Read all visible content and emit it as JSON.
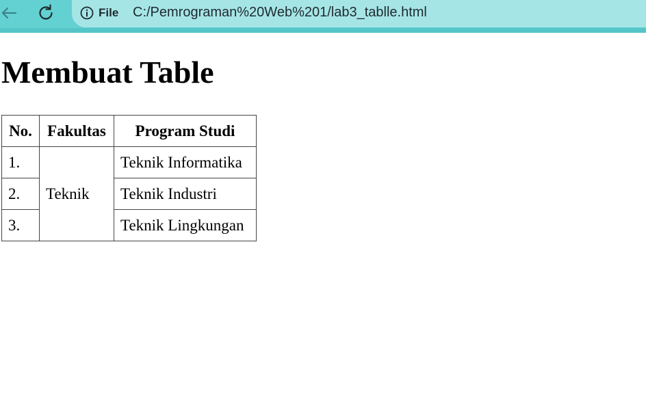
{
  "browser": {
    "site_info_label": "File",
    "url": "C:/Pemrograman%20Web%201/lab3_tablle.html"
  },
  "page": {
    "title": "Membuat Table",
    "table": {
      "headers": [
        "No.",
        "Fakultas",
        "Program Studi"
      ],
      "fakultas": "Teknik",
      "rows": [
        {
          "no": "1.",
          "program_studi": "Teknik Informatika"
        },
        {
          "no": "2.",
          "program_studi": "Teknik Industri"
        },
        {
          "no": "3.",
          "program_studi": "Teknik Lingkungan"
        }
      ]
    }
  },
  "colors": {
    "toolbar": "#63d0d2",
    "address_bar": "#a6e5e6",
    "table_border": "#444444"
  },
  "icons": {
    "back": "arrow-left-icon",
    "reload": "reload-icon",
    "site_info": "info-circle-icon"
  }
}
